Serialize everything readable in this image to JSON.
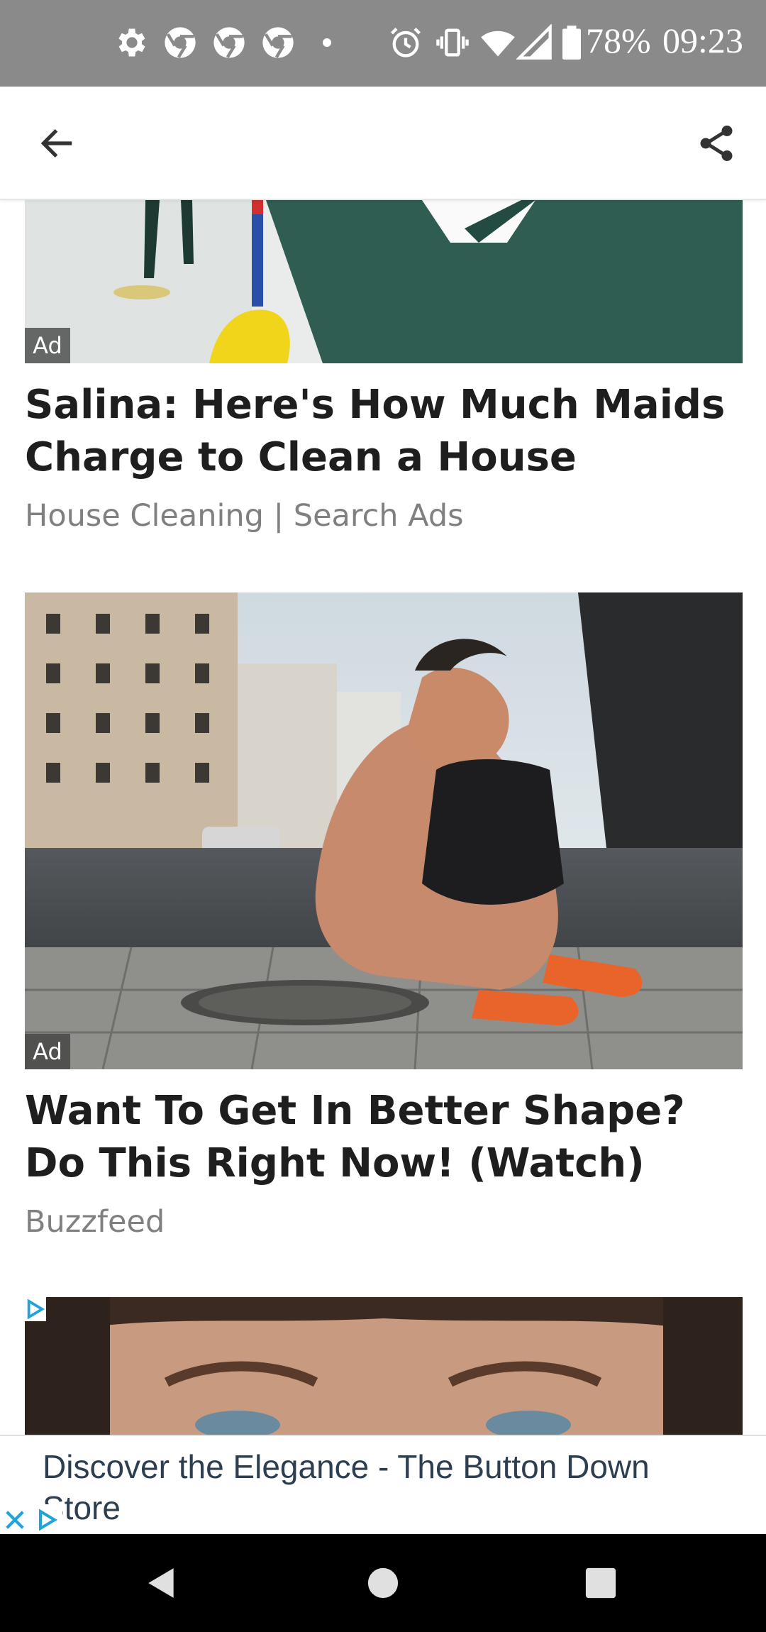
{
  "status_bar": {
    "battery": "78%",
    "time": "09:23",
    "icons": [
      "settings-icon",
      "chrome-icon",
      "chrome-icon",
      "chrome-icon",
      "notification-dot-icon",
      "alarm-icon",
      "vibrate-icon",
      "wifi-icon",
      "signal-icon",
      "battery-icon"
    ]
  },
  "app_bar": {
    "back_icon": "back-arrow-icon",
    "share_icon": "share-icon"
  },
  "feed": {
    "items": [
      {
        "badge": "Ad",
        "title": "Salina: Here's How Much Maids Charge to Clean a House",
        "source": "House Cleaning | Search Ads",
        "image": "cleaning-photo"
      },
      {
        "badge": "Ad",
        "title": "Want To Get In Better Shape? Do This Right Now! (Watch)",
        "source": "Buzzfeed",
        "image": "runner-tying-shoe-photo"
      },
      {
        "badge_icon": "adchoices-icon",
        "image": "face-closeup-photo"
      }
    ]
  },
  "banner": {
    "text": "Discover the Elegance - The Button Down Store",
    "close_icon": "close-icon",
    "adchoices_icon": "adchoices-icon"
  },
  "nav_bar": {
    "buttons": [
      "back-triangle-icon",
      "home-circle-icon",
      "recents-square-icon"
    ]
  },
  "colors": {
    "status_bar_bg": "#8a8a8a",
    "title_text": "#1e1e1e",
    "source_text": "#808080",
    "banner_text": "#2d3e50",
    "adchoices_accent": "#1fa3d8"
  }
}
